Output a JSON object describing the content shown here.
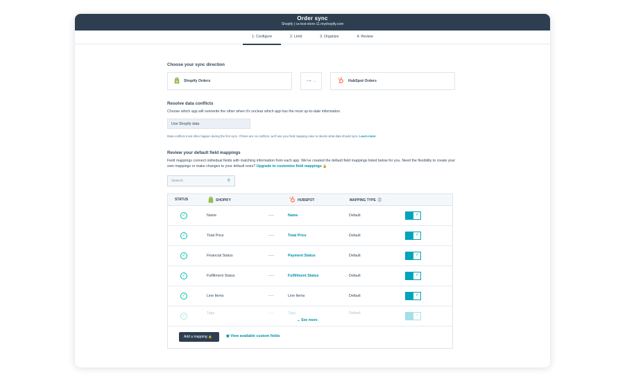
{
  "header": {
    "title": "Order sync",
    "subtitle": "Shopify | cs-test-store-11.myshopify.com"
  },
  "steps": [
    {
      "label": "1. Configure",
      "active": true
    },
    {
      "label": "2. Limit"
    },
    {
      "label": "3. Organize"
    },
    {
      "label": "4. Review"
    }
  ],
  "direction": {
    "title": "Choose your sync direction",
    "left_app": "Shopify Orders",
    "right_app": "HubSpot Orders",
    "arrow": "⟶",
    "caret": "⌄"
  },
  "conflicts": {
    "title": "Resolve data conflicts",
    "description": "Choose which app will overwrite the other when it's unclear which app has the most up-to-date information.",
    "selected": "Use Shopify data",
    "note": "Data conflicts most often happen during the first sync. If there are no conflicts, we'll use your field mapping rules to decide what data should sync.",
    "learn_more": "Learn more"
  },
  "mappings": {
    "title": "Review your default field mappings",
    "description": "Field mappings connect individual fields with matching information from each app. We've created the default field mappings listed below for you. Need the flexibility to create your own mappings or make changes to your default ones?",
    "upgrade_link": "Upgrade to customize field mappings",
    "search_placeholder": "Search",
    "columns": {
      "status": "STATUS",
      "shopify": "SHOPIFY",
      "hubspot": "HUBSPOT",
      "mapping_type": "MAPPING TYPE"
    },
    "rows": [
      {
        "shopify": "Name",
        "hubspot": "Name",
        "hubspot_link": true,
        "type": "Default"
      },
      {
        "shopify": "Total Price",
        "hubspot": "Total Price",
        "hubspot_link": true,
        "type": "Default"
      },
      {
        "shopify": "Financial Status",
        "hubspot": "Payment Status",
        "hubspot_link": true,
        "type": "Default"
      },
      {
        "shopify": "Fulfillment Status",
        "hubspot": "Fulfillment Status",
        "hubspot_link": true,
        "type": "Default"
      },
      {
        "shopify": "Line Items",
        "hubspot": "Line Items",
        "hubspot_link": false,
        "type": "Default"
      },
      {
        "shopify": "Tags",
        "hubspot": "Tags",
        "hubspot_link": false,
        "type": "Default"
      }
    ],
    "see_more": "See more",
    "add_mapping": "Add a mapping",
    "view_custom": "View available custom fields"
  },
  "colors": {
    "header_bg": "#2d3e50",
    "accent": "#0091ae",
    "toggle": "#00a4bd",
    "check": "#00bda5",
    "shopify_green": "#95bf47",
    "hubspot_orange": "#ff7a59"
  }
}
